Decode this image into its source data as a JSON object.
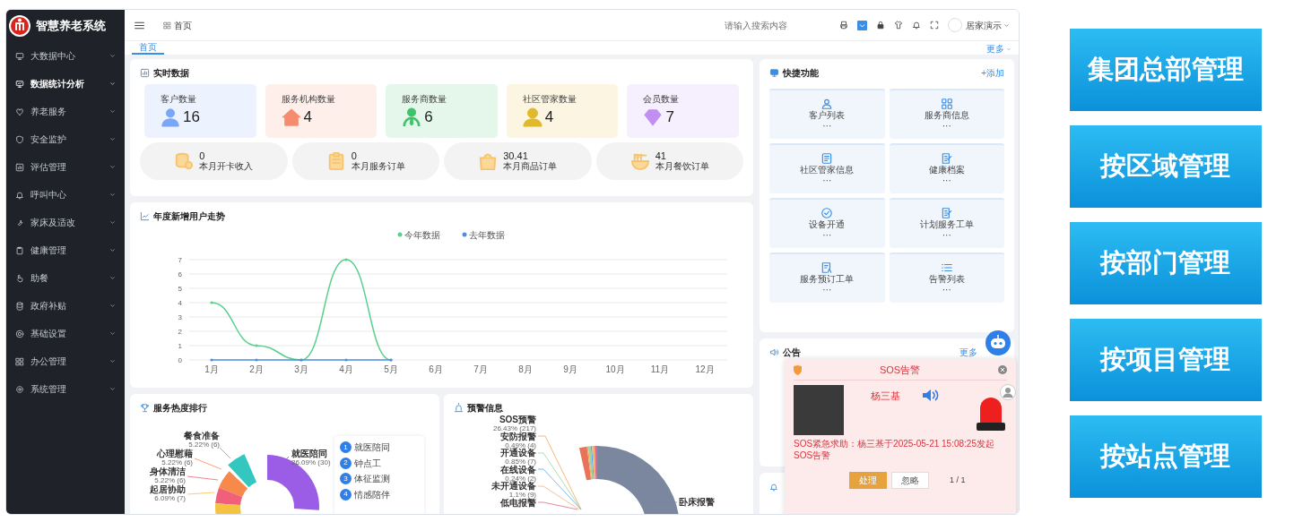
{
  "app": {
    "title": "智慧养老系统"
  },
  "sidebar": {
    "items": [
      {
        "label": "大数据中心",
        "selected": false
      },
      {
        "label": "数据统计分析",
        "selected": true
      },
      {
        "label": "养老服务",
        "selected": false
      },
      {
        "label": "安全监护",
        "selected": false
      },
      {
        "label": "评估管理",
        "selected": false
      },
      {
        "label": "呼叫中心",
        "selected": false
      },
      {
        "label": "家床及适改",
        "selected": false
      },
      {
        "label": "健康管理",
        "selected": false
      },
      {
        "label": "助餐",
        "selected": false
      },
      {
        "label": "政府补贴",
        "selected": false
      },
      {
        "label": "基础设置",
        "selected": false
      },
      {
        "label": "办公管理",
        "selected": false
      },
      {
        "label": "系统管理",
        "selected": false
      }
    ]
  },
  "header": {
    "breadcrumb": "首页",
    "search": {
      "placeholder": "请输入搜索内容"
    },
    "user": "居家演示"
  },
  "tabs": [
    {
      "label": "首页",
      "selected": true
    }
  ],
  "tabs_more": "更多",
  "realtime": {
    "title": "实时数据",
    "stats": [
      {
        "label": "客户数量",
        "value": "16",
        "color": "#7aa7f5"
      },
      {
        "label": "服务机构数量",
        "value": "4",
        "color": "#f58c6e"
      },
      {
        "label": "服务商数量",
        "value": "6",
        "color": "#3ec36a"
      },
      {
        "label": "社区管家数量",
        "value": "4",
        "color": "#e0b92c"
      },
      {
        "label": "会员数量",
        "value": "7",
        "color": "#c18ef2"
      }
    ],
    "orders": [
      {
        "value": "0",
        "label": "本月开卡收入"
      },
      {
        "value": "0",
        "label": "本月服务订单"
      },
      {
        "value": "30.41",
        "label": "本月商品订单"
      },
      {
        "value": "41",
        "label": "本月餐饮订单"
      }
    ]
  },
  "trend": {
    "title": "年度新增用户走势",
    "chart_data": {
      "type": "line",
      "categories": [
        "1月",
        "2月",
        "3月",
        "4月",
        "5月",
        "6月",
        "7月",
        "8月",
        "9月",
        "10月",
        "11月",
        "12月"
      ],
      "ylim": [
        0,
        7
      ],
      "yticks": [
        0,
        1,
        2,
        3,
        4,
        5,
        6,
        7
      ],
      "grid": true,
      "legend": "top",
      "series": [
        {
          "name": "今年数据",
          "color": "#5ad08e",
          "values": [
            4,
            1,
            0,
            7,
            0,
            null,
            null,
            null,
            null,
            null,
            null,
            null
          ]
        },
        {
          "name": "去年数据",
          "color": "#4a8fe3",
          "values": [
            0,
            0,
            0,
            0,
            0,
            null,
            null,
            null,
            null,
            null,
            null,
            null
          ]
        }
      ]
    }
  },
  "service_ranking": {
    "title": "服务热度排行",
    "slices": [
      {
        "name": "餐食准备",
        "value": "5.22% (6)",
        "color": "#34c7c0"
      },
      {
        "name": "心理慰藉",
        "value": "5.22% (6)",
        "color": "#f7894a"
      },
      {
        "name": "就医陪同",
        "value": "26.09% (30)",
        "color": "#9b5de5"
      },
      {
        "name": "身体清洁",
        "value": "5.22% (6)",
        "color": "#f0607a"
      },
      {
        "name": "起居协助",
        "value": "6.09% (7)",
        "color": "#f5c342"
      }
    ],
    "ranking": [
      {
        "rank": "1",
        "label": "就医陪同"
      },
      {
        "rank": "2",
        "label": "钟点工"
      },
      {
        "rank": "3",
        "label": "体征监测"
      },
      {
        "rank": "4",
        "label": "情感陪伴"
      }
    ]
  },
  "warnings": {
    "title": "预警信息",
    "slices": [
      {
        "name": "SOS预警",
        "value": "26.43% (217)",
        "color": "#e8735a"
      },
      {
        "name": "安防报警",
        "value": "0.49% (4)",
        "color": "#f2a65a"
      },
      {
        "name": "开通设备",
        "value": "0.85% (7)",
        "color": "#9bd4a0"
      },
      {
        "name": "在线设备",
        "value": "0.24% (2)",
        "color": "#5aa9e6"
      },
      {
        "name": "未开通设备",
        "value": "1.1% (9)",
        "color": "#f3b27a"
      },
      {
        "name": "低电报警",
        "color": "#e06a8a"
      },
      {
        "name": "卧床报警",
        "color": "#7a879e"
      }
    ]
  },
  "quick": {
    "title": "快捷功能",
    "add": "+添加",
    "items": [
      {
        "label": "客户列表",
        "more": "···"
      },
      {
        "label": "服务商信息",
        "more": "···"
      },
      {
        "label": "社区管家信息",
        "more": "···"
      },
      {
        "label": "健康档案",
        "more": "···"
      },
      {
        "label": "设备开通",
        "more": "···"
      },
      {
        "label": "计划服务工单",
        "more": "···"
      },
      {
        "label": "服务预订工单",
        "more": "···"
      },
      {
        "label": "告警列表",
        "more": "···"
      }
    ]
  },
  "notice": {
    "title": "公告",
    "more": "更多"
  },
  "sos": {
    "title": "SOS告警",
    "name": "杨三基",
    "message": "SOS紧急求助：杨三基于2025-05-21 15:08:25发起SOS告警",
    "buttons": [
      {
        "label": "处理",
        "kind": "primary"
      },
      {
        "label": "忽略",
        "kind": "plain"
      }
    ],
    "pager": "1 / 1"
  },
  "scope_buttons": [
    "集团总部管理",
    "按区域管理",
    "按部门管理",
    "按项目管理",
    "按站点管理"
  ]
}
